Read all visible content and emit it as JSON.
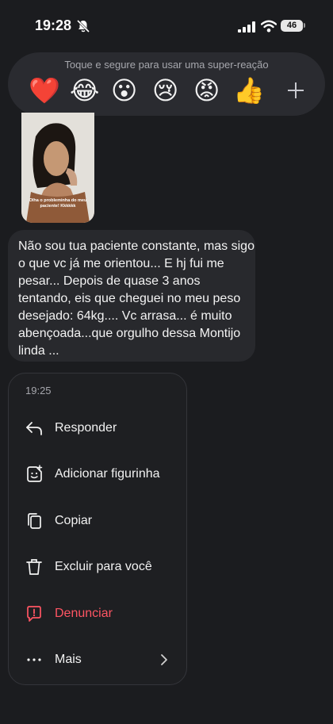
{
  "status_bar": {
    "time": "19:28",
    "battery": "46",
    "icons": [
      "mute-bell-icon",
      "cellular-signal-icon",
      "wifi-icon",
      "battery-icon"
    ]
  },
  "reaction_bar": {
    "hint": "Toque e segure para usar uma super-reação",
    "reactions": [
      "❤️",
      "😂",
      "😮",
      "😢",
      "😡",
      "👍"
    ],
    "more_icon": "plus-icon"
  },
  "story": {
    "caption": "Olha o probleminha do meu paciente! Kkkkkk"
  },
  "message": {
    "text": "Não sou tua paciente constante, mas sigo o que vc já me orientou... E hj fui me pesar... Depois de quase 3 anos tentando, eis que cheguei no meu peso desejado: 64kg.... Vc arrasa... é muito abençoada...que orgulho dessa Montijo linda ..."
  },
  "context_menu": {
    "time": "19:25",
    "items": [
      {
        "label": "Responder",
        "icon": "reply-arrow-icon"
      },
      {
        "label": "Adicionar figurinha",
        "icon": "sticker-icon"
      },
      {
        "label": "Copiar",
        "icon": "copy-icon"
      },
      {
        "label": "Excluir para você",
        "icon": "trash-icon"
      },
      {
        "label": "Denunciar",
        "icon": "report-icon"
      },
      {
        "label": "Mais",
        "icon": "more-dots-icon"
      }
    ],
    "danger_color": "#ff5563"
  },
  "colors": {
    "background": "#1b1c1f",
    "bubble": "#28292d",
    "menu": "#1e1f22"
  }
}
